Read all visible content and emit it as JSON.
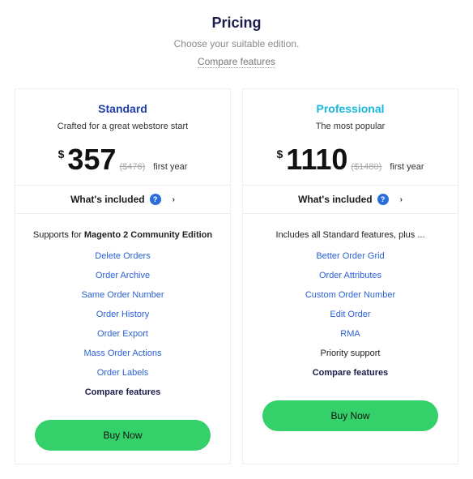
{
  "header": {
    "title": "Pricing",
    "subtitle": "Choose your suitable edition.",
    "compare": "Compare features"
  },
  "common": {
    "currency": "$",
    "period": "first year",
    "included": "What's included",
    "compare_features": "Compare features",
    "buy": "Buy Now"
  },
  "plans": {
    "standard": {
      "name": "Standard",
      "tagline": "Crafted for a great webstore start",
      "price": "357",
      "old_price": "($476)",
      "features_head_prefix": "Supports for ",
      "features_head_bold": "Magento 2 Community Edition",
      "features": [
        "Delete Orders",
        "Order Archive",
        "Same Order Number",
        "Order History",
        "Order Export",
        "Mass Order Actions",
        "Order Labels"
      ]
    },
    "professional": {
      "name": "Professional",
      "tagline": "The most popular",
      "price": "1110",
      "old_price": "($1480)",
      "features_head": "Includes all Standard features, plus ...",
      "features": [
        "Better Order Grid",
        "Order Attributes",
        "Custom Order Number",
        "Edit Order",
        "RMA"
      ],
      "static_feature": "Priority support"
    }
  }
}
